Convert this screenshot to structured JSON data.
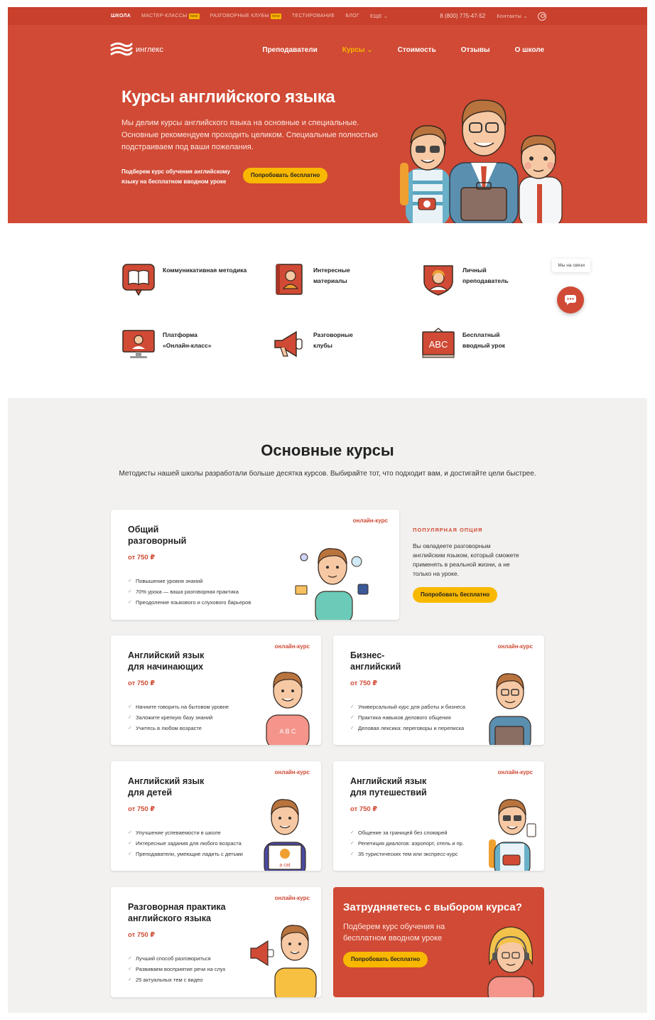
{
  "topbar": {
    "items": [
      {
        "label": "Школа",
        "active": true
      },
      {
        "label": "Мастер-классы",
        "badge": "new"
      },
      {
        "label": "Разговорные клубы",
        "badge": "new"
      },
      {
        "label": "Тестирование"
      },
      {
        "label": "Блог"
      },
      {
        "label": "Еще ⌄"
      }
    ],
    "phone": "8 (800) 775-47-52",
    "contacts": "Контакты ⌄"
  },
  "nav": {
    "logo_text": "инглекс",
    "links": [
      "Преподаватели",
      "Курсы ⌄",
      "Стоимость",
      "Отзывы",
      "О школе"
    ]
  },
  "hero": {
    "title": "Курсы английского языка",
    "description": "Мы делим курсы английского языка на основные и специальные. Основные рекомендуем проходить целиком. Специальные полностью подстраиваем под ваши пожелания.",
    "promo": "Подберем курс обучения английскому языку на бесплатном вводном уроке",
    "button": "Попробовать бесплатно"
  },
  "features": [
    {
      "label": "Коммуникативная методика",
      "icon": "book-icon"
    },
    {
      "label": "Интересные материалы",
      "icon": "textbook-icon"
    },
    {
      "label": "Личный преподаватель",
      "icon": "teacher-icon"
    },
    {
      "label": "Платформа «Онлайн-класс»",
      "icon": "monitor-icon"
    },
    {
      "label": "Разговорные клубы",
      "icon": "megaphone-icon"
    },
    {
      "label": "Бесплатный вводный урок",
      "icon": "blackboard-icon"
    }
  ],
  "chat": {
    "bubble": "Мы на связи"
  },
  "courses_section": {
    "title": "Основные курсы",
    "subtitle": "Методисты нашей школы разработали больше десятка курсов. Выбирайте тот, что подходит вам, и достигайте цели быстрее.",
    "tag": "онлайн-курс",
    "price": "от 750 ₽",
    "popular": {
      "label": "Популярная опция",
      "text": "Вы овладеете разговорным английским языком, который сможете применять в реальной жизни, а не только на уроке.",
      "button": "Попробовать бесплатно"
    },
    "courses": [
      {
        "title": "Общий разговорный",
        "bullets": [
          "Повышение уровня знаний",
          "70% урока — ваша разговорная практика",
          "Преодоление языкового и слухового барьеров"
        ]
      },
      {
        "title": "Английский язык для начинающих",
        "bullets": [
          "Начните говорить на бытовом уровне",
          "Заложите крепкую базу знаний",
          "Учитесь в любом возрасте"
        ]
      },
      {
        "title": "Бизнес-английский",
        "bullets": [
          "Универсальный курс для работы и бизнеса",
          "Практика навыков делового общения",
          "Деловая лексика: переговоры и переписка"
        ]
      },
      {
        "title": "Английский язык для детей",
        "bullets": [
          "Улучшение успеваемости в школе",
          "Интересные задания для любого возраста",
          "Преподаватели, умеющие ладить с детьми"
        ]
      },
      {
        "title": "Английский язык для путешествий",
        "bullets": [
          "Общение за границей без словарей",
          "Репетиция диалогов: аэропорт, отель и пр.",
          "35 туристических тем или экспресс-курс"
        ]
      },
      {
        "title": "Разговорная практика английского языка",
        "bullets": [
          "Лучший способ разговориться",
          "Развиваем восприятие речи на слух",
          "25 актуальных тем с видео"
        ]
      }
    ],
    "help": {
      "title": "Затрудняетесь с выбором курса?",
      "text": "Подберем курс обучения на бесплатном вводном уроке",
      "button": "Попробовать бесплатно"
    },
    "art_labels": {
      "abc": "A B C",
      "cat": "a cat"
    }
  },
  "colors": {
    "brand": "#d04a35",
    "accent": "#f8b800",
    "bg_light": "#f2f1ef"
  }
}
